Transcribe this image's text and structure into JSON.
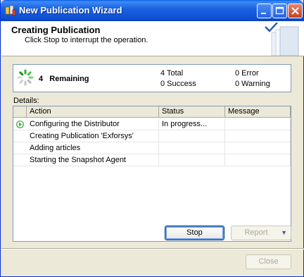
{
  "window": {
    "title": "New Publication Wizard"
  },
  "header": {
    "title": "Creating Publication",
    "subtitle": "Click Stop to interrupt the operation."
  },
  "summary": {
    "remaining_count": "4",
    "remaining_label": "Remaining",
    "total": "4 Total",
    "success": "0 Success",
    "error": "0 Error",
    "warning": "0 Warning"
  },
  "details": {
    "label": "Details:",
    "columns": [
      "Action",
      "Status",
      "Message"
    ],
    "rows": [
      {
        "action": "Configuring the Distributor",
        "status": "In progress...",
        "message": "",
        "icon": "in-progress-arrow-icon"
      },
      {
        "action": "Creating Publication 'Exforsys'",
        "status": "",
        "message": ""
      },
      {
        "action": "Adding articles",
        "status": "",
        "message": ""
      },
      {
        "action": "Starting the Snapshot Agent",
        "status": "",
        "message": ""
      }
    ]
  },
  "buttons": {
    "stop": "Stop",
    "report": "Report",
    "close": "Close"
  },
  "colors": {
    "titlebar": "#0a5fe6",
    "progress_green": "#2fae2f"
  }
}
